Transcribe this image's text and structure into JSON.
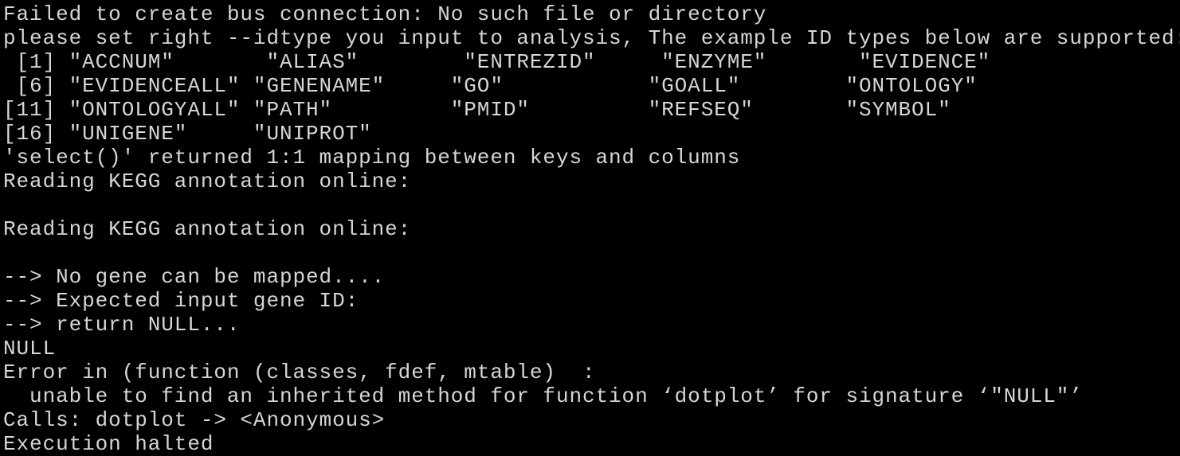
{
  "terminal": {
    "background_color": "#000000",
    "text_color": "#d6d6d6",
    "lines": [
      {
        "id": "line-dbus-error",
        "text": "Failed to create bus connection: No such file or directory"
      },
      {
        "id": "line-idtype-hint",
        "text": "please set right --idtype you input to analysis, The example ID types below are supported:"
      },
      {
        "id": "line-idtypes-1",
        "text": " [1] \"ACCNUM\"       \"ALIAS\"        \"ENTREZID\"     \"ENZYME\"       \"EVIDENCE\""
      },
      {
        "id": "line-idtypes-6",
        "text": " [6] \"EVIDENCEALL\" \"GENENAME\"     \"GO\"           \"GOALL\"        \"ONTOLOGY\""
      },
      {
        "id": "line-idtypes-11",
        "text": "[11] \"ONTOLOGYALL\" \"PATH\"         \"PMID\"         \"REFSEQ\"       \"SYMBOL\""
      },
      {
        "id": "line-idtypes-16",
        "text": "[16] \"UNIGENE\"     \"UNIPROT\""
      },
      {
        "id": "line-select-mapping",
        "text": "'select()' returned 1:1 mapping between keys and columns"
      },
      {
        "id": "line-reading-kegg-1",
        "text": "Reading KEGG annotation online:"
      },
      {
        "id": "line-blank-1",
        "text": ""
      },
      {
        "id": "line-reading-kegg-2",
        "text": "Reading KEGG annotation online:"
      },
      {
        "id": "line-blank-2",
        "text": ""
      },
      {
        "id": "line-no-gene-mapped",
        "text": "--> No gene can be mapped...."
      },
      {
        "id": "line-expected-input",
        "text": "--> Expected input gene ID: "
      },
      {
        "id": "line-return-null",
        "text": "--> return NULL..."
      },
      {
        "id": "line-null",
        "text": "NULL"
      },
      {
        "id": "line-error-in",
        "text": "Error in (function (classes, fdef, mtable)  : "
      },
      {
        "id": "line-error-detail",
        "text": "  unable to find an inherited method for function ‘dotplot’ for signature ‘\"NULL\"’"
      },
      {
        "id": "line-calls",
        "text": "Calls: dotplot -> <Anonymous>"
      },
      {
        "id": "line-execution-halted",
        "text": "Execution halted"
      }
    ]
  }
}
